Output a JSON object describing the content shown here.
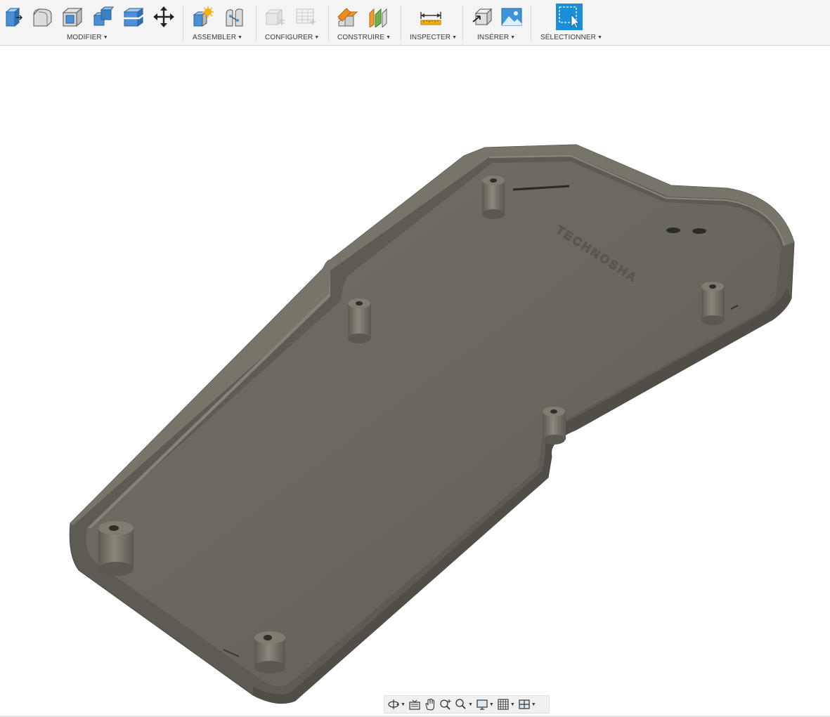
{
  "toolbar": {
    "groups": [
      {
        "label": "MODIFIER",
        "tools": [
          "press-pull-icon",
          "fillet-icon",
          "shell-icon",
          "combine-icon",
          "split-face-icon",
          "move-icon"
        ]
      },
      {
        "label": "ASSEMBLER",
        "tools": [
          "new-component-icon",
          "joint-icon"
        ]
      },
      {
        "label": "CONFIGURER",
        "tools": [
          "configure-model-icon",
          "configuration-table-icon"
        ]
      },
      {
        "label": "CONSTRUIRE",
        "tools": [
          "offset-plane-icon",
          "midplane-icon"
        ]
      },
      {
        "label": "INSPECTER",
        "tools": [
          "measure-icon"
        ]
      },
      {
        "label": "INSÉRER",
        "tools": [
          "insert-derive-icon",
          "insert-image-icon"
        ]
      },
      {
        "label": "SÉLECTIONNER",
        "tools": [
          "select-icon"
        ]
      }
    ],
    "accent": "#1a8fd6"
  },
  "viewport": {
    "model": "enclosure-bottom-shell",
    "embossed_text": "TECHNOSHA",
    "model_color": "#6e6b62",
    "background": "#ffffff"
  },
  "navbar": {
    "tools": [
      "orbit-icon",
      "look-at-icon",
      "pan-icon",
      "zoom-window-icon",
      "zoom-fit-icon",
      "display-settings-icon",
      "grid-settings-icon",
      "viewports-icon"
    ]
  }
}
